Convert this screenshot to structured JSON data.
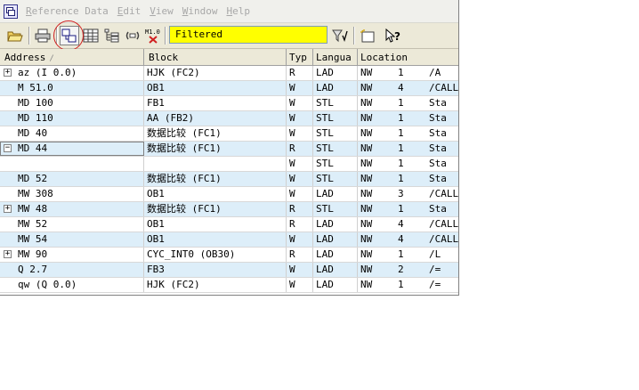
{
  "menu": {
    "items": [
      {
        "label": "Reference Data",
        "mnemonic": "R"
      },
      {
        "label": "Edit",
        "mnemonic": "E"
      },
      {
        "label": "View",
        "mnemonic": "V"
      },
      {
        "label": "Window",
        "mnemonic": "W"
      },
      {
        "label": "Help",
        "mnemonic": "H"
      }
    ]
  },
  "toolbar": {
    "filter_value": "Filtered"
  },
  "table": {
    "columns": [
      "Address",
      "Block",
      "Typ",
      "Langua",
      "Location"
    ],
    "sort_indicator": "/",
    "rows": [
      {
        "expand": "+",
        "address": "az (I 0.0)",
        "block": "HJK (FC2)",
        "typ": "R",
        "lang": "LAD",
        "loc1": "NW",
        "loc2": "1",
        "loc3": "/A"
      },
      {
        "expand": "",
        "address": "M 51.0",
        "block": "OB1",
        "typ": "W",
        "lang": "LAD",
        "loc1": "NW",
        "loc2": "4",
        "loc3": "/CALL"
      },
      {
        "expand": "",
        "address": "MD 100",
        "block": "FB1",
        "typ": "W",
        "lang": "STL",
        "loc1": "NW",
        "loc2": "1",
        "loc3": "Sta"
      },
      {
        "expand": "",
        "address": "MD 110",
        "block": "AA (FB2)",
        "typ": "W",
        "lang": "STL",
        "loc1": "NW",
        "loc2": "1",
        "loc3": "Sta"
      },
      {
        "expand": "",
        "address": "MD 40",
        "block": "数据比较 (FC1)",
        "typ": "W",
        "lang": "STL",
        "loc1": "NW",
        "loc2": "1",
        "loc3": "Sta"
      },
      {
        "expand": "−",
        "address": "MD 44",
        "block": "数据比较 (FC1)",
        "typ": "R",
        "lang": "STL",
        "loc1": "NW",
        "loc2": "1",
        "loc3": "Sta"
      },
      {
        "expand": "",
        "address": "",
        "block": "",
        "typ": "W",
        "lang": "STL",
        "loc1": "NW",
        "loc2": "1",
        "loc3": "Sta"
      },
      {
        "expand": "",
        "address": "MD 52",
        "block": "数据比较 (FC1)",
        "typ": "W",
        "lang": "STL",
        "loc1": "NW",
        "loc2": "1",
        "loc3": "Sta"
      },
      {
        "expand": "",
        "address": "MW 308",
        "block": "OB1",
        "typ": "W",
        "lang": "LAD",
        "loc1": "NW",
        "loc2": "3",
        "loc3": "/CALL"
      },
      {
        "expand": "+",
        "address": "MW 48",
        "block": "数据比较 (FC1)",
        "typ": "R",
        "lang": "STL",
        "loc1": "NW",
        "loc2": "1",
        "loc3": "Sta"
      },
      {
        "expand": "",
        "address": "MW 52",
        "block": "OB1",
        "typ": "R",
        "lang": "LAD",
        "loc1": "NW",
        "loc2": "4",
        "loc3": "/CALL"
      },
      {
        "expand": "",
        "address": "MW 54",
        "block": "OB1",
        "typ": "W",
        "lang": "LAD",
        "loc1": "NW",
        "loc2": "4",
        "loc3": "/CALL"
      },
      {
        "expand": "+",
        "address": "MW 90",
        "block": "CYC_INT0 (OB30)",
        "typ": "R",
        "lang": "LAD",
        "loc1": "NW",
        "loc2": "1",
        "loc3": "/L"
      },
      {
        "expand": "",
        "address": "Q 2.7",
        "block": "FB3",
        "typ": "W",
        "lang": "LAD",
        "loc1": "NW",
        "loc2": "2",
        "loc3": "/="
      },
      {
        "expand": "",
        "address": "qw (Q 0.0)",
        "block": "HJK (FC2)",
        "typ": "W",
        "lang": "LAD",
        "loc1": "NW",
        "loc2": "1",
        "loc3": "/="
      }
    ]
  },
  "colors": {
    "filter_bg": "#ffff00",
    "row_alt_bg": "#ddeef9",
    "highlight_circle": "#d02020"
  },
  "icons": [
    "app-icon",
    "open-folder-icon",
    "print-icon",
    "cross-reference-icon",
    "grid-icon",
    "tree-icon",
    "unused-symbols-icon",
    "no-symbol-icon",
    "filter-icon",
    "new-window-icon",
    "help-icon"
  ]
}
